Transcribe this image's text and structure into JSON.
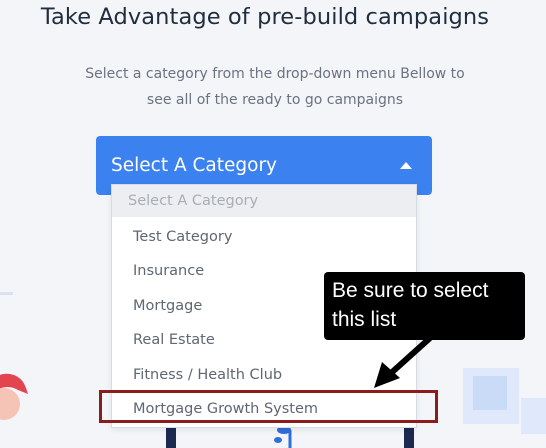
{
  "header": {
    "title": "Take Advantage of pre-build campaigns",
    "subtitle_line1": "Select a category from the drop-down menu Bellow to",
    "subtitle_line2": "see all of the ready to go campaigns"
  },
  "category_select": {
    "label": "Select A Category",
    "expanded": true,
    "caret_icon": "caret-up-icon",
    "accent_color": "#3b82f0"
  },
  "dropdown": {
    "placeholder": "Select A Category",
    "options": [
      "Test Category",
      "Insurance",
      "Mortgage",
      "Real Estate",
      "Fitness / Health Club",
      "Mortgage Growth System"
    ]
  },
  "annotation": {
    "callout_line1": "Be sure to select",
    "callout_line2": "this list",
    "highlight_color": "#8c1c1c",
    "arrow_icon": "pointer-arrow-icon"
  }
}
